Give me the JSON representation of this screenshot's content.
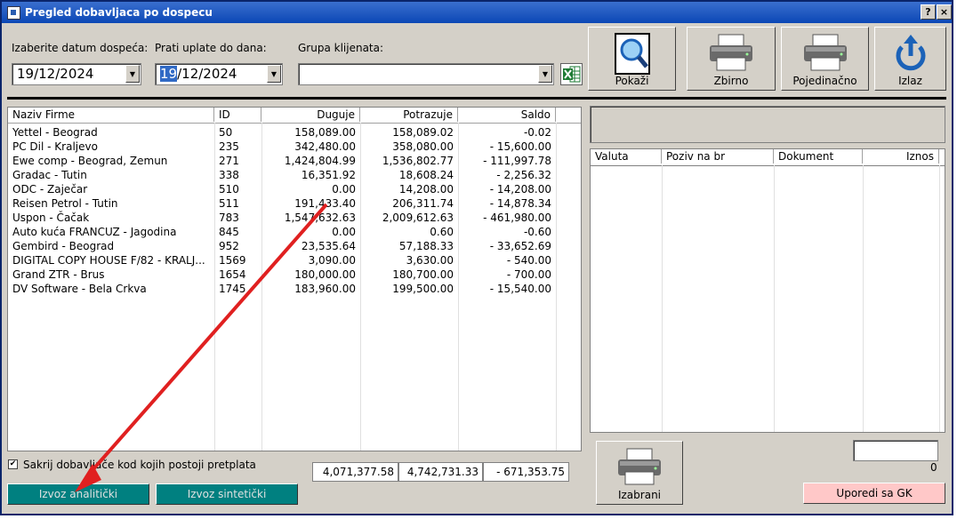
{
  "window": {
    "title": "Pregled dobavljaca po dospecu",
    "help_label": "?",
    "close_label": "×"
  },
  "filters": {
    "date_due_label": "Izaberite datum dospeća:",
    "date_due_value": "19/12/2024",
    "track_label": "Prati uplate do dana:",
    "track_day_selected": "19",
    "track_rest": "/12/2024",
    "group_label": "Grupa klijenata:",
    "group_value": ""
  },
  "toolbar": {
    "show": "Pokaži",
    "summary": "Zbirno",
    "individual": "Pojedinačno",
    "exit": "Izlaz"
  },
  "main_table": {
    "columns": [
      "Naziv Firme",
      "ID",
      "Duguje",
      "Potrazuje",
      "Saldo"
    ],
    "rows": [
      [
        "Yettel - Beograd",
        "50",
        "158,089.00",
        "158,089.02",
        "-0.02"
      ],
      [
        "PC Dil - Kraljevo",
        "235",
        "342,480.00",
        "358,080.00",
        "- 15,600.00"
      ],
      [
        "Ewe comp - Beograd, Zemun",
        "271",
        "1,424,804.99",
        "1,536,802.77",
        "- 111,997.78"
      ],
      [
        "Gradac - Tutin",
        "338",
        "16,351.92",
        "18,608.24",
        "- 2,256.32"
      ],
      [
        "ODC - Zaječar",
        "510",
        "0.00",
        "14,208.00",
        "- 14,208.00"
      ],
      [
        "Reisen Petrol - Tutin",
        "511",
        "191,433.40",
        "206,311.74",
        "- 14,878.34"
      ],
      [
        "Uspon - Čačak",
        "783",
        "1,547,632.63",
        "2,009,612.63",
        "- 461,980.00"
      ],
      [
        "Auto kuća FRANCUZ - Jagodina",
        "845",
        "0.00",
        "0.60",
        "-0.60"
      ],
      [
        "Gembird - Beograd",
        "952",
        "23,535.64",
        "57,188.33",
        "- 33,652.69"
      ],
      [
        "DIGITAL COPY HOUSE  F/82 - KRALJ...",
        "1569",
        "3,090.00",
        "3,630.00",
        "- 540.00"
      ],
      [
        "Grand ZTR - Brus",
        "1654",
        "180,000.00",
        "180,700.00",
        "- 700.00"
      ],
      [
        "DV Software - Bela Crkva",
        "1745",
        "183,960.00",
        "199,500.00",
        "- 15,540.00"
      ]
    ]
  },
  "detail_table": {
    "columns": [
      "Valuta",
      "Poziv na br",
      "Dokument",
      "Iznos"
    ]
  },
  "bottom": {
    "hide_checkbox_label": "Sakrij dobavljače kod kojih postoji pretplata",
    "hide_checkbox_mark": "✔",
    "total_debit": "4,071,377.58",
    "total_credit": "4,742,731.33",
    "total_balance": "- 671,353.75",
    "export_analytic": "Izvoz analitički",
    "export_synthetic": "Izvoz sintetički",
    "selected": "Izabrani",
    "side_value": "0",
    "compare_gk": "Uporedi sa GK"
  },
  "colors": {
    "title_bar": "#0b47b5",
    "teal": "#008080",
    "pink": "#ffc8c8",
    "arrow": "#e02020"
  }
}
